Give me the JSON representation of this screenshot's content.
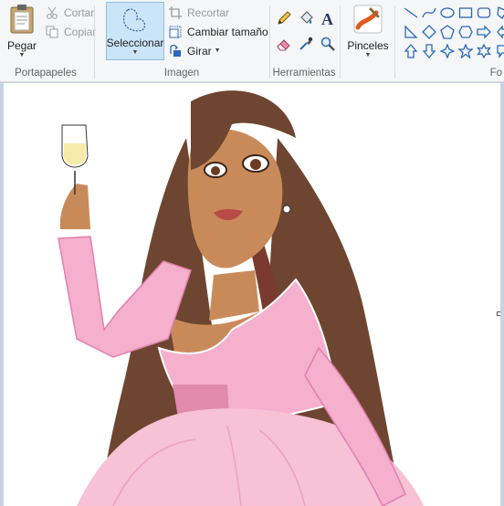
{
  "clipboard": {
    "group_label": "Portapapeles",
    "paste": "Pegar",
    "cut": "Cortar",
    "copy": "Copiar"
  },
  "image": {
    "group_label": "Imagen",
    "select": "Seleccionar",
    "crop": "Recortar",
    "resize": "Cambiar tamaño",
    "rotate": "Girar"
  },
  "tools": {
    "group_label": "Herramientas",
    "items": [
      "pencil-icon",
      "fill-icon",
      "text-icon",
      "eraser-icon",
      "color-picker-icon",
      "magnifier-icon"
    ]
  },
  "brushes": {
    "label": "Pinceles"
  },
  "shapes": {
    "group_label": "Fo",
    "items": [
      "line",
      "curve",
      "oval",
      "rectangle",
      "rounded-rectangle",
      "polygon",
      "triangle",
      "right-triangle",
      "diamond",
      "pentagon",
      "hexagon",
      "arrow-right",
      "arrow-left",
      "arrow-up",
      "arrow-down",
      "star-4",
      "star-5",
      "star-6"
    ]
  },
  "colors": {
    "accent": "#cce4f7",
    "canvas": "#ffffff",
    "workspace": "#c6d3e2",
    "dress": "#f4b0cc",
    "hair": "#6e4530",
    "skin": "#c98a5a"
  }
}
